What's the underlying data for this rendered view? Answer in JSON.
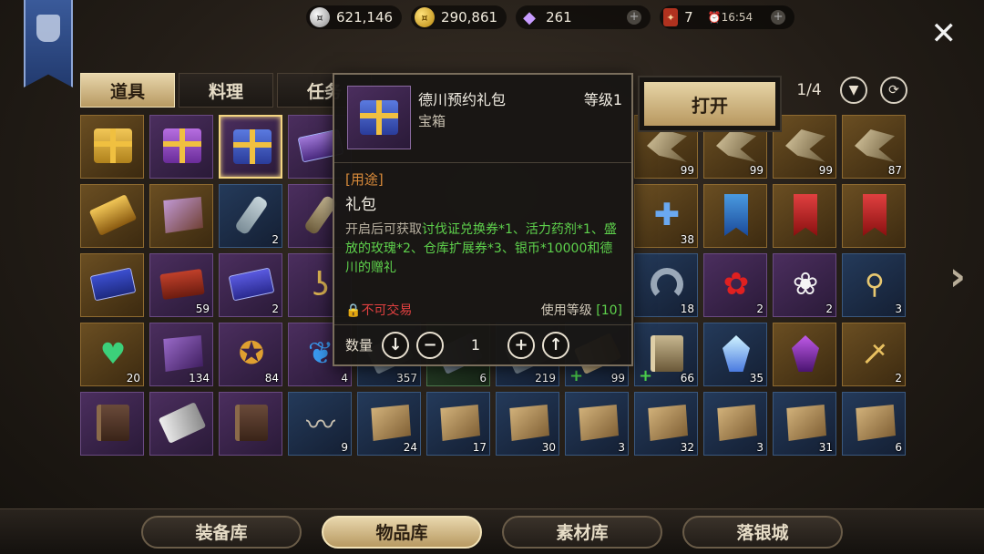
{
  "currency": {
    "silver": "621,146",
    "gold": "290,861",
    "gems": "261",
    "tickets": "7",
    "timer": "16:54"
  },
  "tabs": [
    {
      "label": "道具",
      "active": true
    },
    {
      "label": "料理",
      "active": false
    },
    {
      "label": "任务",
      "active": false
    }
  ],
  "pager": {
    "page": "1/4"
  },
  "tooltip": {
    "name": "德川预约礼包",
    "type": "宝箱",
    "level": "等级1",
    "use_label": "[用途]",
    "use_head": "礼包",
    "desc_prefix": "开启后可获取",
    "desc_green": "讨伐证兑换券*1、活力药剂*1、盛放的玫瑰*2、仓库扩展券*3、银币*10000和德川的赠礼",
    "trade": "不可交易",
    "use_level_label": "使用等级",
    "use_level_value": "[10]",
    "qty_label": "数量",
    "qty_value": "1"
  },
  "open_button": "打开",
  "bottom_nav": [
    {
      "label": "装备库",
      "active": false
    },
    {
      "label": "物品库",
      "active": true
    },
    {
      "label": "素材库",
      "active": false
    },
    {
      "label": "落银城",
      "active": false
    }
  ],
  "inventory": [
    {
      "icon": "gold-gift-box-icon",
      "rarity": "gold",
      "count": ""
    },
    {
      "icon": "purple-gift-box-icon",
      "rarity": "purple",
      "count": ""
    },
    {
      "icon": "blue-gift-box-icon",
      "rarity": "purple",
      "count": "",
      "selected": true
    },
    {
      "icon": "purple-scroll-icon",
      "rarity": "purple",
      "count": ""
    },
    {
      "icon": "hidden",
      "rarity": "",
      "count": ""
    },
    {
      "icon": "hidden",
      "rarity": "",
      "count": ""
    },
    {
      "icon": "hidden",
      "rarity": "",
      "count": ""
    },
    {
      "icon": "hidden",
      "rarity": "",
      "count": ""
    },
    {
      "icon": "wing-charm-icon",
      "rarity": "gold",
      "count": "99"
    },
    {
      "icon": "wing-charm-icon",
      "rarity": "gold",
      "count": "99"
    },
    {
      "icon": "wing-charm-icon",
      "rarity": "gold",
      "count": "99"
    },
    {
      "icon": "wing-charm-icon",
      "rarity": "gold",
      "count": "87"
    },
    {
      "icon": "golden-glove-icon",
      "rarity": "gold",
      "count": ""
    },
    {
      "icon": "purple-map-icon",
      "rarity": "gold",
      "count": ""
    },
    {
      "icon": "bottle-letter-icon",
      "rarity": "blue",
      "count": "2"
    },
    {
      "icon": "bottle-icon",
      "rarity": "purple",
      "count": ""
    },
    {
      "icon": "hidden",
      "rarity": "",
      "count": ""
    },
    {
      "icon": "hidden",
      "rarity": "",
      "count": ""
    },
    {
      "icon": "hidden",
      "rarity": "",
      "count": ""
    },
    {
      "icon": "hidden",
      "rarity": "",
      "count": ""
    },
    {
      "icon": "puzzle-piece-icon",
      "rarity": "gold",
      "count": "38"
    },
    {
      "icon": "blue-banner-icon",
      "rarity": "gold",
      "count": ""
    },
    {
      "icon": "red-banner-icon",
      "rarity": "gold",
      "count": ""
    },
    {
      "icon": "red-banner-icon",
      "rarity": "gold",
      "count": ""
    },
    {
      "icon": "blue-ticket-icon",
      "rarity": "gold",
      "count": ""
    },
    {
      "icon": "red-ticket-icon",
      "rarity": "purple",
      "count": "59"
    },
    {
      "icon": "discount-ticket-icon",
      "rarity": "purple",
      "count": "2"
    },
    {
      "icon": "hook-icon",
      "rarity": "purple",
      "count": ""
    },
    {
      "icon": "hidden",
      "rarity": "",
      "count": ""
    },
    {
      "icon": "hidden",
      "rarity": "",
      "count": ""
    },
    {
      "icon": "hidden",
      "rarity": "",
      "count": ""
    },
    {
      "icon": "hidden",
      "rarity": "",
      "count": ""
    },
    {
      "icon": "horseshoe-icon",
      "rarity": "blue",
      "count": "18"
    },
    {
      "icon": "red-rose-icon",
      "rarity": "purple",
      "count": "2"
    },
    {
      "icon": "white-lily-icon",
      "rarity": "purple",
      "count": "2"
    },
    {
      "icon": "bone-key-icon",
      "rarity": "blue",
      "count": "3"
    },
    {
      "icon": "heart-brooch-icon",
      "rarity": "gold",
      "count": "20"
    },
    {
      "icon": "purple-rune-icon",
      "rarity": "purple",
      "count": "134"
    },
    {
      "icon": "star-medal-icon",
      "rarity": "purple",
      "count": "84"
    },
    {
      "icon": "blue-butterfly-icon",
      "rarity": "purple",
      "count": "4"
    },
    {
      "icon": "item-icon",
      "rarity": "blue",
      "count": "357"
    },
    {
      "icon": "item-icon",
      "rarity": "green",
      "count": "6"
    },
    {
      "icon": "item-icon",
      "rarity": "blue",
      "count": "219"
    },
    {
      "icon": "upgrade-item-icon",
      "rarity": "blue",
      "count": "99",
      "upgrade": true
    },
    {
      "icon": "backpack-icon",
      "rarity": "blue",
      "count": "66",
      "upgrade": true
    },
    {
      "icon": "crystal-gem-icon",
      "rarity": "blue",
      "count": "35"
    },
    {
      "icon": "purple-gem-icon",
      "rarity": "gold",
      "count": ""
    },
    {
      "icon": "ruby-sword-icon",
      "rarity": "gold",
      "count": "2"
    },
    {
      "icon": "leather-book-icon",
      "rarity": "purple",
      "count": ""
    },
    {
      "icon": "scroll-case-icon",
      "rarity": "purple",
      "count": ""
    },
    {
      "icon": "leather-book-icon",
      "rarity": "purple",
      "count": ""
    },
    {
      "icon": "brush-icon",
      "rarity": "blue",
      "count": "9"
    },
    {
      "icon": "sword-blueprint-icon",
      "rarity": "blue",
      "count": "24"
    },
    {
      "icon": "sword-blueprint-icon",
      "rarity": "blue",
      "count": "17"
    },
    {
      "icon": "bow-blueprint-icon",
      "rarity": "blue",
      "count": "30"
    },
    {
      "icon": "bow-blueprint-icon",
      "rarity": "blue",
      "count": "3"
    },
    {
      "icon": "bow-blueprint-icon",
      "rarity": "blue",
      "count": "32"
    },
    {
      "icon": "bow-blueprint-icon",
      "rarity": "blue",
      "count": "3"
    },
    {
      "icon": "crossed-blueprint-icon",
      "rarity": "blue",
      "count": "31"
    },
    {
      "icon": "crossed-blueprint-icon",
      "rarity": "blue",
      "count": "6"
    }
  ]
}
